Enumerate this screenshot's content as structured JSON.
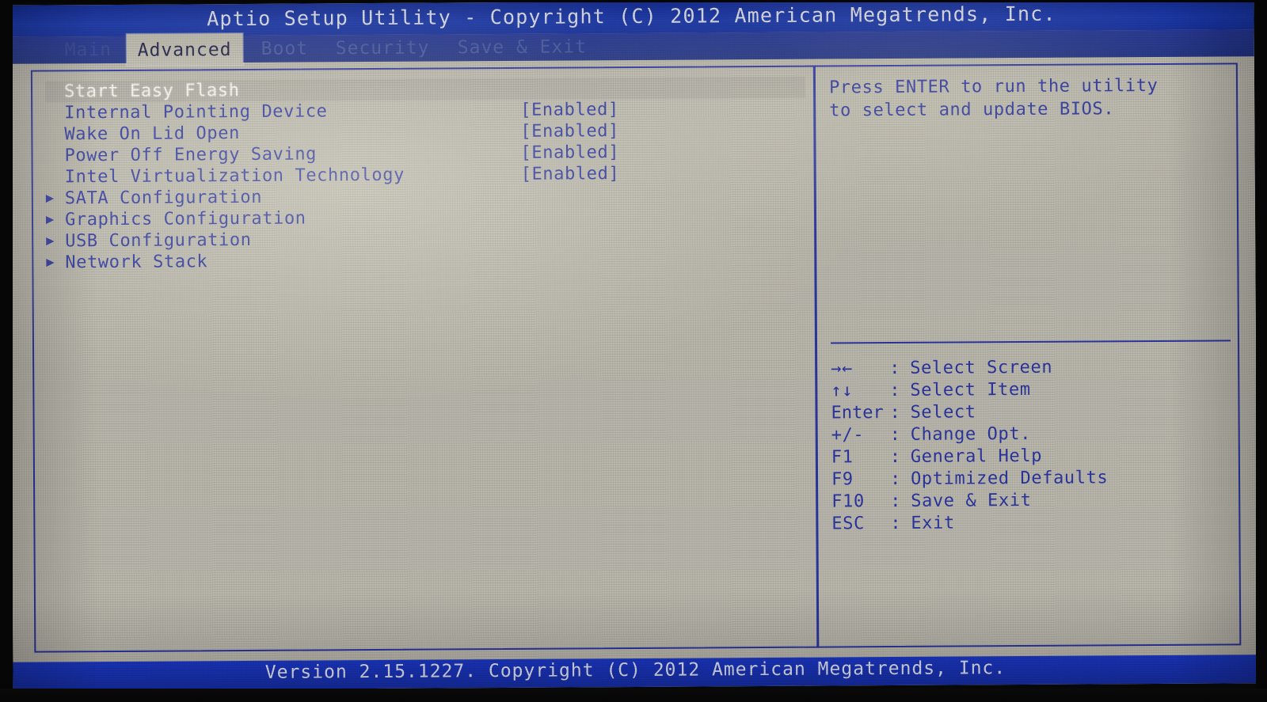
{
  "titlebar": {
    "text": "Aptio Setup Utility - Copyright (C) 2012 American Megatrends, Inc."
  },
  "tabs": [
    {
      "label": "Main",
      "active": false,
      "visibility": "faded"
    },
    {
      "label": "Advanced",
      "active": true,
      "visibility": "normal"
    },
    {
      "label": "Boot",
      "active": false,
      "visibility": "faded"
    },
    {
      "label": "Security",
      "active": false,
      "visibility": "faded"
    },
    {
      "label": "Save & Exit",
      "active": false,
      "visibility": "faded"
    }
  ],
  "settings": [
    {
      "label": "Start Easy Flash",
      "value": "",
      "submenu": false,
      "selected": true
    },
    {
      "label": "Internal Pointing Device",
      "value": "[Enabled]",
      "submenu": false,
      "selected": false
    },
    {
      "label": "Wake On Lid Open",
      "value": "[Enabled]",
      "submenu": false,
      "selected": false
    },
    {
      "label": "Power Off Energy Saving",
      "value": "[Enabled]",
      "submenu": false,
      "selected": false
    },
    {
      "label": "Intel Virtualization Technology",
      "value": "[Enabled]",
      "submenu": false,
      "selected": false
    },
    {
      "label": "SATA Configuration",
      "value": "",
      "submenu": true,
      "selected": false
    },
    {
      "label": "Graphics Configuration",
      "value": "",
      "submenu": true,
      "selected": false
    },
    {
      "label": "USB Configuration",
      "value": "",
      "submenu": true,
      "selected": false
    },
    {
      "label": "Network Stack",
      "value": "",
      "submenu": true,
      "selected": false
    }
  ],
  "help": {
    "line1": "Press ENTER to run the utility",
    "line2": "to select and update BIOS."
  },
  "keylegend": [
    {
      "key": "→←",
      "colon": ":",
      "desc": "Select Screen",
      "icon": "arrow-left-right-icon"
    },
    {
      "key": "↑↓",
      "colon": ":",
      "desc": "Select Item",
      "icon": "arrow-up-down-icon"
    },
    {
      "key": "Enter",
      "colon": ":",
      "desc": "Select",
      "icon": "enter-key-icon"
    },
    {
      "key": "+/-",
      "colon": ":",
      "desc": "Change Opt.",
      "icon": "plus-minus-key-icon"
    },
    {
      "key": "F1",
      "colon": ":",
      "desc": "General Help",
      "icon": "f1-key-icon"
    },
    {
      "key": "F9",
      "colon": ":",
      "desc": "Optimized Defaults",
      "icon": "f9-key-icon"
    },
    {
      "key": "F10",
      "colon": ":",
      "desc": "Save & Exit",
      "icon": "f10-key-icon"
    },
    {
      "key": "ESC",
      "colon": ":",
      "desc": "Exit",
      "icon": "esc-key-icon"
    }
  ],
  "bottombar": {
    "text": "Version 2.15.1227. Copyright (C) 2012 American Megatrends, Inc."
  },
  "colors": {
    "title_bar_blue": "#1a35a8",
    "tab_bar_blue": "#24378f",
    "screen_background": "#b9b6ac",
    "text_blue": "#2b35a0",
    "selected_text": "#f3f2ee",
    "bottom_bar_blue": "#1a35c0"
  }
}
